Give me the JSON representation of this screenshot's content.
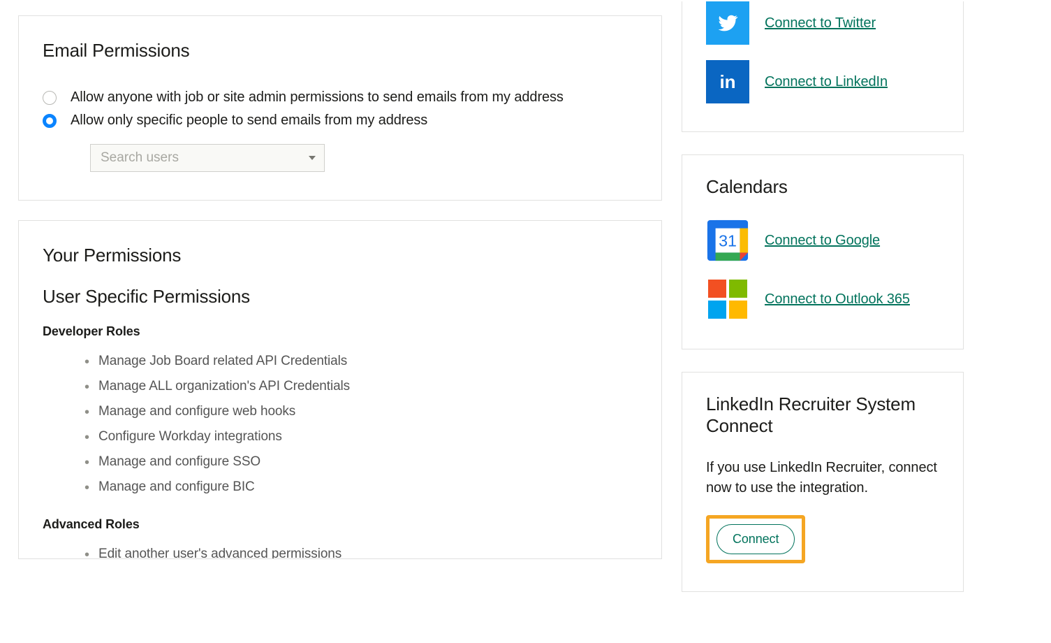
{
  "email_permissions": {
    "title": "Email Permissions",
    "option_anyone": "Allow anyone with job or site admin permissions to send emails from my address",
    "option_specific": "Allow only specific people to send emails from my address",
    "search_placeholder": "Search users"
  },
  "your_permissions": {
    "title": "Your Permissions",
    "subtitle": "User Specific Permissions",
    "developer_heading": "Developer Roles",
    "developer_items": [
      "Manage Job Board related API Credentials",
      "Manage ALL organization's API Credentials",
      "Manage and configure web hooks",
      "Configure Workday integrations",
      "Manage and configure SSO",
      "Manage and configure BIC"
    ],
    "advanced_heading": "Advanced Roles",
    "advanced_items": [
      "Edit another user's advanced permissions"
    ]
  },
  "social": {
    "twitter_label": "Connect to Twitter",
    "linkedin_label": "Connect to LinkedIn"
  },
  "calendars": {
    "title": "Calendars",
    "google_label": "Connect to Google",
    "outlook_label": "Connect to Outlook 365"
  },
  "lrsc": {
    "title": "LinkedIn Recruiter System Connect",
    "description": "If you use LinkedIn Recruiter, connect now to use the integration.",
    "button": "Connect"
  }
}
